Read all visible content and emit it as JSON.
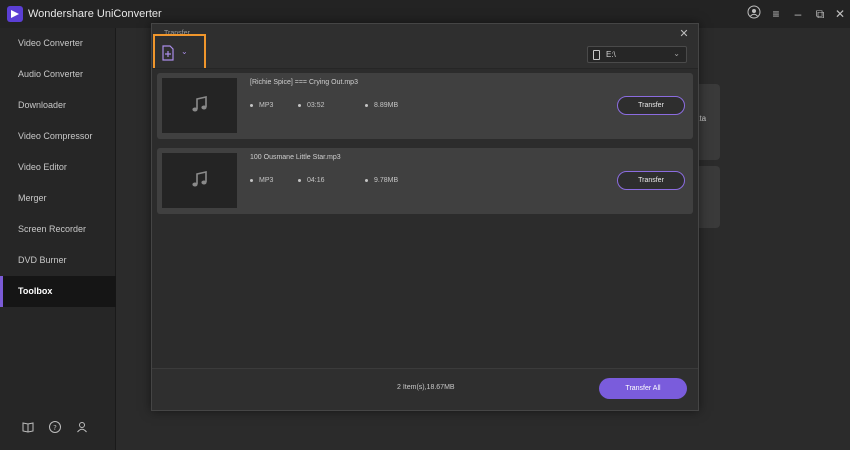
{
  "app": {
    "title": "Wondershare UniConverter",
    "window_controls": [
      "user-icon",
      "menu-icon",
      "minimize-icon",
      "restore-icon",
      "close-icon"
    ]
  },
  "sidebar": {
    "items": [
      {
        "label": "Video Converter",
        "active": false
      },
      {
        "label": "Audio Converter",
        "active": false
      },
      {
        "label": "Downloader",
        "active": false
      },
      {
        "label": "Video Compressor",
        "active": false
      },
      {
        "label": "Video Editor",
        "active": false
      },
      {
        "label": "Merger",
        "active": false
      },
      {
        "label": "Screen Recorder",
        "active": false
      },
      {
        "label": "DVD Burner",
        "active": false
      },
      {
        "label": "Toolbox",
        "active": true
      }
    ],
    "footer_icons": [
      "book-icon",
      "help-icon",
      "account-icon"
    ]
  },
  "background": {
    "card_text": "ata"
  },
  "dialog": {
    "title": "Transfer",
    "device": {
      "label": "E:\\"
    },
    "files": [
      {
        "name": "[Richie Spice] === Crying Out.mp3",
        "format": "MP3",
        "duration": "03:52",
        "size": "8.89MB",
        "button": "Transfer"
      },
      {
        "name": "100 Ousmane Little Star.mp3",
        "format": "MP3",
        "duration": "04:16",
        "size": "9.78MB",
        "button": "Transfer"
      }
    ],
    "summary": "2 Item(s),18.67MB",
    "transfer_all": "Transfer All"
  },
  "colors": {
    "accent": "#7a5cdc",
    "highlight": "#f0962c",
    "background": "#2b2b2b"
  }
}
